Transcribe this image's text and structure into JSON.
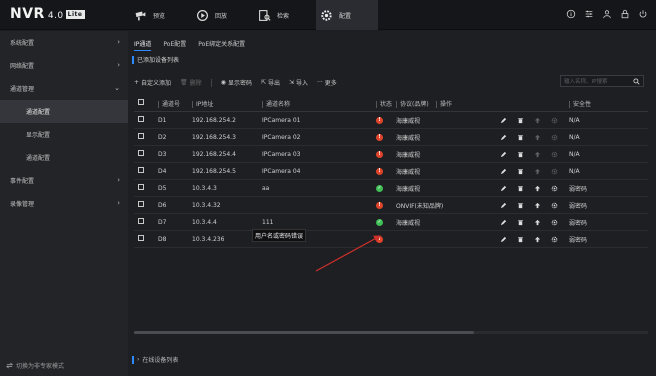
{
  "app": {
    "logo": "NVR",
    "version": "4.0",
    "edition": "Lite"
  },
  "topnav": [
    {
      "label": "预览",
      "icon": "camera-icon"
    },
    {
      "label": "回放",
      "icon": "playback-icon"
    },
    {
      "label": "检索",
      "icon": "search-file-icon"
    },
    {
      "label": "配置",
      "icon": "gear-icon",
      "active": true
    }
  ],
  "topicons": [
    "info-icon",
    "settings-icon",
    "user-icon",
    "lock-icon",
    "power-icon"
  ],
  "sidebar": {
    "items": [
      {
        "label": "系统配置",
        "chevron": "›"
      },
      {
        "label": "网络配置",
        "chevron": "›"
      },
      {
        "label": "通道管理",
        "chevron": "⌄"
      },
      {
        "label": "通道配置",
        "sub": true,
        "active": true
      },
      {
        "label": "显示配置",
        "sub": true
      },
      {
        "label": "通道配置",
        "sub": true
      },
      {
        "label": "事件配置",
        "chevron": "›"
      },
      {
        "label": "录像管理",
        "chevron": "›"
      }
    ],
    "bottom": "切换为非专家模式"
  },
  "tabs": [
    "IP通道",
    "PoE配置",
    "PoE绑定关系配置"
  ],
  "section_title": "已添加设备列表",
  "toolbar": {
    "add": "自定义添加",
    "delete": "删除",
    "show_password": "显示密码",
    "export": "导出",
    "import": "导入",
    "more": "更多"
  },
  "search": {
    "placeholder": "输入名称、IP搜索"
  },
  "table": {
    "headers": [
      "通道号",
      "IP地址",
      "通道名称",
      "状态",
      "协议(品牌)",
      "操作",
      "安全性"
    ],
    "rows": [
      {
        "ch": "D1",
        "ip": "192.168.254.2",
        "name": "IPCamera 01",
        "status": "error",
        "protocol": "海康威视",
        "security": "N/A"
      },
      {
        "ch": "D2",
        "ip": "192.168.254.3",
        "name": "IPCamera 02",
        "status": "error",
        "protocol": "海康威视",
        "security": "N/A"
      },
      {
        "ch": "D3",
        "ip": "192.168.254.4",
        "name": "IPCamera 03",
        "status": "error",
        "protocol": "海康威视",
        "security": "N/A"
      },
      {
        "ch": "D4",
        "ip": "192.168.254.5",
        "name": "IPCamera 04",
        "status": "error",
        "protocol": "海康威视",
        "security": "N/A"
      },
      {
        "ch": "D5",
        "ip": "10.3.4.3",
        "name": "aa",
        "status": "ok",
        "protocol": "海康威视",
        "security": "弱密码"
      },
      {
        "ch": "D6",
        "ip": "10.3.4.32",
        "name": "",
        "status": "error",
        "protocol": "ONVIF(未知品牌)",
        "security": "弱密码"
      },
      {
        "ch": "D7",
        "ip": "10.3.4.4",
        "name": "111",
        "status": "ok",
        "protocol": "海康威视",
        "security": "弱密码"
      },
      {
        "ch": "D8",
        "ip": "10.3.4.236",
        "name": "IPCamera 08",
        "status": "error",
        "protocol": "",
        "security": "弱密码"
      }
    ]
  },
  "tooltip": "用户名或密码错误",
  "footer_link": "在线设备列表",
  "colors": {
    "accent": "#2e8bff",
    "error": "#e0452b",
    "ok": "#3fbf55",
    "arrow": "#d0302a"
  }
}
